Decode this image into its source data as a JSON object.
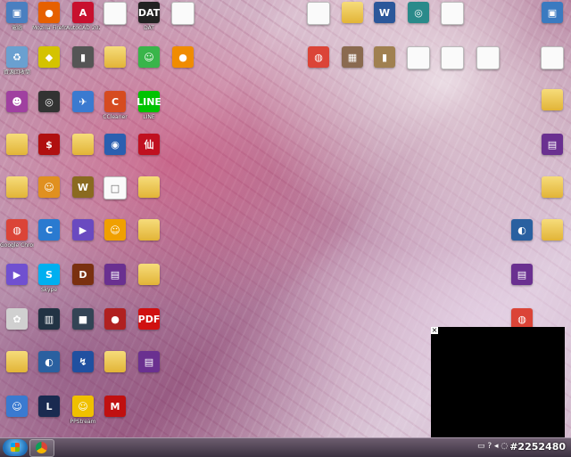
{
  "desktop": {
    "icons": [
      {
        "label": "電腦",
        "glyph": "▣",
        "color": "#4a7fc0"
      },
      {
        "label": "Mozilla Firefox",
        "glyph": "●",
        "color": "#e66000"
      },
      {
        "label": "AutoCAD 2020 - 繁...",
        "glyph": "A",
        "color": "#c8102e"
      },
      {
        "label": "",
        "glyph": "",
        "color": "doc"
      },
      {
        "label": "DAT",
        "glyph": "DAT",
        "color": "#222222"
      },
      {
        "label": "",
        "glyph": "",
        "color": "doc"
      },
      {
        "label": "資源回收筒",
        "glyph": "♻",
        "color": "#6aa0d0"
      },
      {
        "label": "",
        "glyph": "◆",
        "color": "#d4c300"
      },
      {
        "label": "",
        "glyph": "▮",
        "color": "#555555"
      },
      {
        "label": "",
        "glyph": "",
        "color": "folder"
      },
      {
        "label": "",
        "glyph": "☺",
        "color": "#39b54a"
      },
      {
        "label": "",
        "glyph": "●",
        "color": "#f08c00"
      },
      {
        "label": "",
        "glyph": "☻",
        "color": "#a040a0"
      },
      {
        "label": "",
        "glyph": "◎",
        "color": "#333333"
      },
      {
        "label": "",
        "glyph": "✈",
        "color": "#3b7ad0"
      },
      {
        "label": "CCleaner",
        "glyph": "C",
        "color": "#d64b20"
      },
      {
        "label": "LINE",
        "glyph": "LINE",
        "color": "#00c300"
      },
      {
        "label": "",
        "glyph": "",
        "color": "folder"
      },
      {
        "label": "",
        "glyph": "$",
        "color": "#b01010"
      },
      {
        "label": "",
        "glyph": "",
        "color": "folder"
      },
      {
        "label": "",
        "glyph": "◉",
        "color": "#2a5fb0"
      },
      {
        "label": "",
        "glyph": "仙",
        "color": "#c01020"
      },
      {
        "label": "",
        "glyph": "",
        "color": "folder"
      },
      {
        "label": "",
        "glyph": "☺",
        "color": "#e09020"
      },
      {
        "label": "",
        "glyph": "W",
        "color": "#8a6a20"
      },
      {
        "label": "",
        "glyph": "□",
        "color": "doc"
      },
      {
        "label": "",
        "glyph": "",
        "color": "folder"
      },
      {
        "label": "Google Chrome",
        "glyph": "◍",
        "color": "#db4437"
      },
      {
        "label": "",
        "glyph": "C",
        "color": "#2a7ad0"
      },
      {
        "label": "",
        "glyph": "▶",
        "color": "#6a4ac0"
      },
      {
        "label": "",
        "glyph": "☺",
        "color": "#f0a000"
      },
      {
        "label": "",
        "glyph": "",
        "color": "folder"
      },
      {
        "label": "",
        "glyph": "▶",
        "color": "#7050d0"
      },
      {
        "label": "Skype",
        "glyph": "S",
        "color": "#00aff0"
      },
      {
        "label": "",
        "glyph": "D",
        "color": "#7a3010"
      },
      {
        "label": "",
        "glyph": "▤",
        "color": "#6a3090"
      },
      {
        "label": "",
        "glyph": "",
        "color": "folder"
      },
      {
        "label": "",
        "glyph": "✿",
        "color": "#d0d0d0"
      },
      {
        "label": "",
        "glyph": "▥",
        "color": "#223344"
      },
      {
        "label": "",
        "glyph": "■",
        "color": "#334455"
      },
      {
        "label": "",
        "glyph": "●",
        "color": "#b02020"
      },
      {
        "label": "",
        "glyph": "PDF",
        "color": "#d01010"
      },
      {
        "label": "",
        "glyph": "",
        "color": "folder"
      },
      {
        "label": "",
        "glyph": "◐",
        "color": "#2a60a0"
      },
      {
        "label": "",
        "glyph": "↯",
        "color": "#2050a0"
      },
      {
        "label": "",
        "glyph": "",
        "color": "folder"
      },
      {
        "label": "",
        "glyph": "▤",
        "color": "#6a3090"
      },
      {
        "label": "",
        "glyph": "☺",
        "color": "#3a7ad0"
      },
      {
        "label": "",
        "glyph": "L",
        "color": "#1a2a50"
      },
      {
        "label": "PPStream",
        "glyph": "☺",
        "color": "#f0c000"
      },
      {
        "label": "",
        "glyph": "M",
        "color": "#c01010"
      },
      {
        "label": "",
        "glyph": "",
        "color": "doc"
      },
      {
        "label": "",
        "glyph": "",
        "color": "folder"
      },
      {
        "label": "",
        "glyph": "W",
        "color": "#2b579a"
      },
      {
        "label": "",
        "glyph": "◎",
        "color": "#2a8a8a"
      },
      {
        "label": "",
        "glyph": "",
        "color": "doc"
      },
      {
        "label": "",
        "glyph": "◍",
        "color": "#db4437"
      },
      {
        "label": "",
        "glyph": "▦",
        "color": "#8a6a50"
      },
      {
        "label": "",
        "glyph": "▮",
        "color": "#a08050"
      },
      {
        "label": "",
        "glyph": "",
        "color": "doc"
      },
      {
        "label": "",
        "glyph": "",
        "color": "doc"
      },
      {
        "label": "",
        "glyph": "",
        "color": "doc"
      },
      {
        "label": "",
        "glyph": "▣",
        "color": "#3a7ac0"
      },
      {
        "label": "",
        "glyph": "",
        "color": "doc"
      },
      {
        "label": "",
        "glyph": "",
        "color": "folder"
      },
      {
        "label": "",
        "glyph": "▤",
        "color": "#6a3090"
      },
      {
        "label": "",
        "glyph": "",
        "color": "folder"
      },
      {
        "label": "",
        "glyph": "",
        "color": "folder"
      },
      {
        "label": "",
        "glyph": "◐",
        "color": "#2a60a0"
      },
      {
        "label": "",
        "glyph": "▤",
        "color": "#6a3090"
      },
      {
        "label": "",
        "glyph": "◍",
        "color": "#db4437"
      }
    ]
  },
  "overlay": {
    "close_glyph": "×"
  },
  "taskbar": {
    "tray_icons": "▭ ? ◂ ◌",
    "watermark": "#2252480"
  }
}
